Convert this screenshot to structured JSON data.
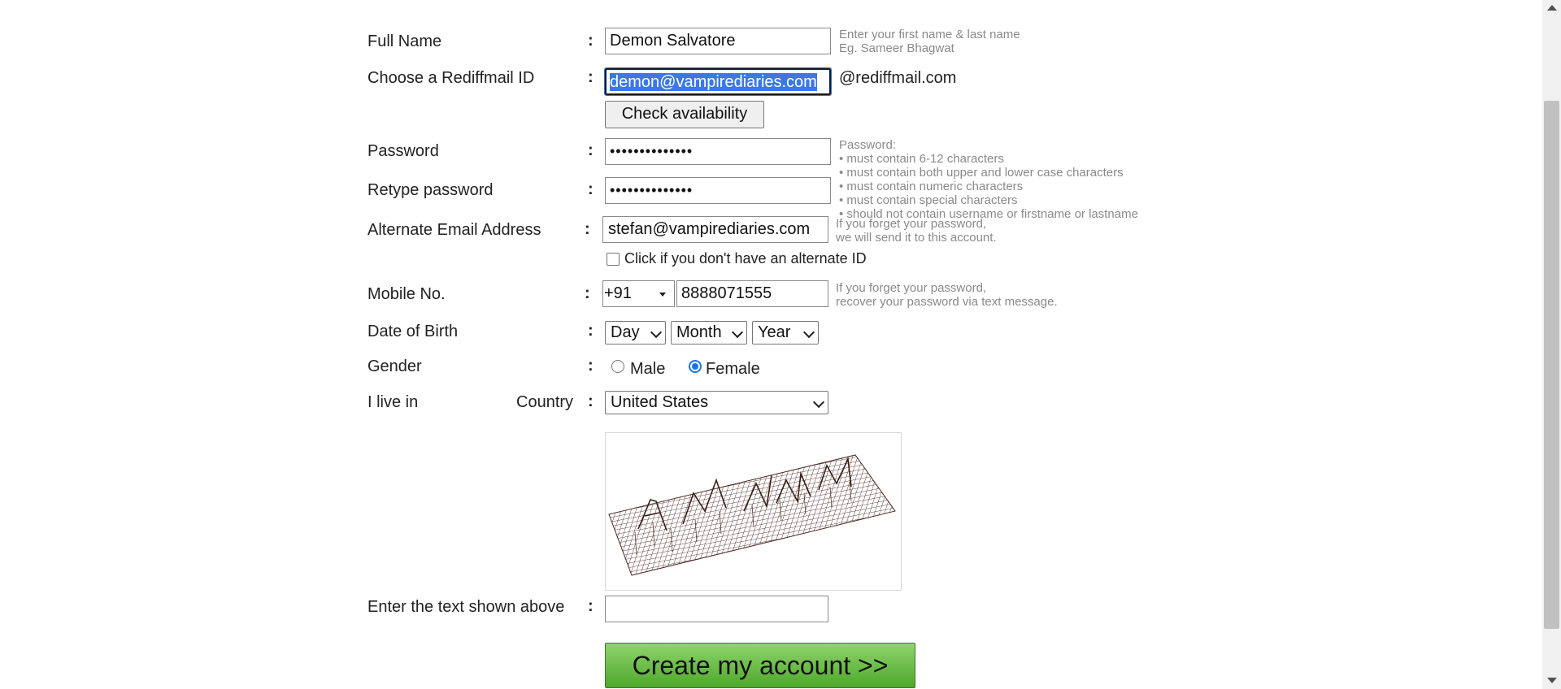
{
  "form": {
    "full_name": {
      "label": "Full Name",
      "value": "Demon Salvatore",
      "hint_line1": "Enter your first name & last name",
      "hint_line2": "Eg. Sameer Bhagwat"
    },
    "rediffmail_id": {
      "label": "Choose a Rediffmail ID",
      "value": "demon@vampirediaries.com",
      "suffix": "@rediffmail.com",
      "check_button": "Check availability"
    },
    "password": {
      "label": "Password",
      "value": "••••••••••••••"
    },
    "retype_password": {
      "label": "Retype password",
      "value": "••••••••••••••"
    },
    "password_hint": {
      "title": "Password:",
      "rules": [
        "• must contain 6-12 characters",
        "• must contain both upper and lower case characters",
        "• must contain numeric characters",
        "• must contain special characters",
        "• should not contain username or firstname or lastname"
      ]
    },
    "alternate_email": {
      "label": "Alternate Email Address",
      "value": "stefan@vampirediaries.com",
      "hint_line1": "If you forget your password,",
      "hint_line2": "we will send it to this account.",
      "checkbox_label": "Click if you don't have an alternate ID"
    },
    "mobile": {
      "label": "Mobile No.",
      "country_code": "+91",
      "value": "8888071555",
      "hint_line1": "If you forget your password,",
      "hint_line2": "recover your password via text message."
    },
    "dob": {
      "label": "Date of Birth",
      "day": "Day",
      "month": "Month",
      "year": "Year"
    },
    "gender": {
      "label": "Gender",
      "male": "Male",
      "female": "Female",
      "selected": "Female"
    },
    "location": {
      "label": "I live in",
      "country_label": "Country",
      "country_value": "United States"
    },
    "captcha": {
      "label": "Enter the text shown above",
      "value": ""
    },
    "submit": "Create my account >>"
  },
  "colon": ":"
}
